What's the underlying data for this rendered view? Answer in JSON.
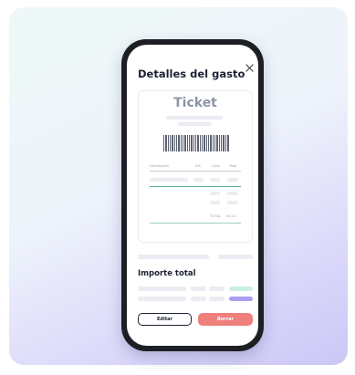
{
  "modal": {
    "title": "Detalles del gasto",
    "close_icon": "close-icon"
  },
  "ticket": {
    "title": "Ticket",
    "columns": [
      "Descripción",
      "IVA",
      "Cant.",
      "Total"
    ],
    "total_label": "TOTAL",
    "total_value": "40,10"
  },
  "summary": {
    "title": "Importe total"
  },
  "actions": {
    "edit_label": "Editar",
    "delete_label": "Borrar"
  },
  "colors": {
    "delete_button": "#ee7f7b",
    "accent_green": "#c9f1df",
    "accent_purple": "#a99ff0"
  }
}
